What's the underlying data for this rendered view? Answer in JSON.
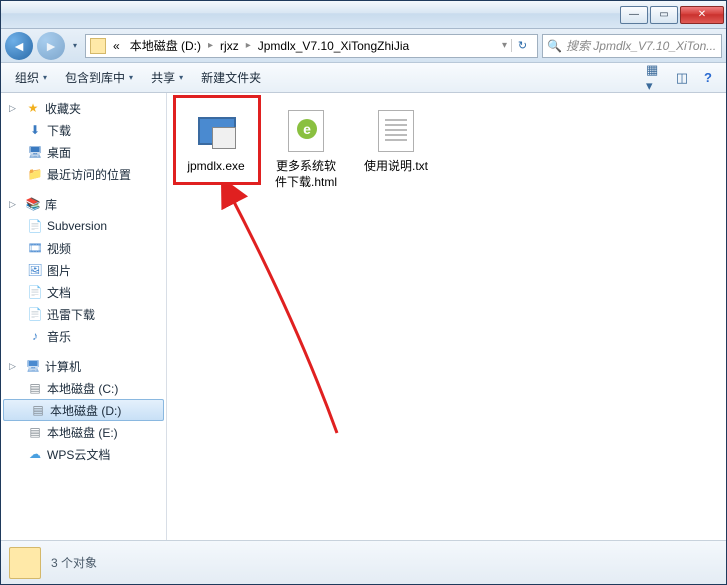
{
  "breadcrumb": {
    "prefix": "«",
    "seg1": "本地磁盘 (D:)",
    "seg2": "rjxz",
    "seg3": "Jpmdlx_V7.10_XiTongZhiJia"
  },
  "search": {
    "placeholder": "搜索 Jpmdlx_V7.10_XiTon..."
  },
  "toolbar": {
    "organize": "组织",
    "include": "包含到库中",
    "share": "共享",
    "newfolder": "新建文件夹"
  },
  "sidebar": {
    "fav": "收藏夹",
    "downloads": "下载",
    "desktop": "桌面",
    "recent": "最近访问的位置",
    "lib": "库",
    "svn": "Subversion",
    "video": "视频",
    "images": "图片",
    "docs": "文档",
    "xunlei": "迅雷下载",
    "music": "音乐",
    "computer": "计算机",
    "driveC": "本地磁盘 (C:)",
    "driveD": "本地磁盘 (D:)",
    "driveE": "本地磁盘 (E:)",
    "wps": "WPS云文档"
  },
  "files": {
    "f0": {
      "name": "jpmdlx.exe"
    },
    "f1": {
      "name": "更多系统软件下载.html"
    },
    "f2": {
      "name": "使用说明.txt"
    }
  },
  "status": {
    "count": "3 个对象"
  }
}
